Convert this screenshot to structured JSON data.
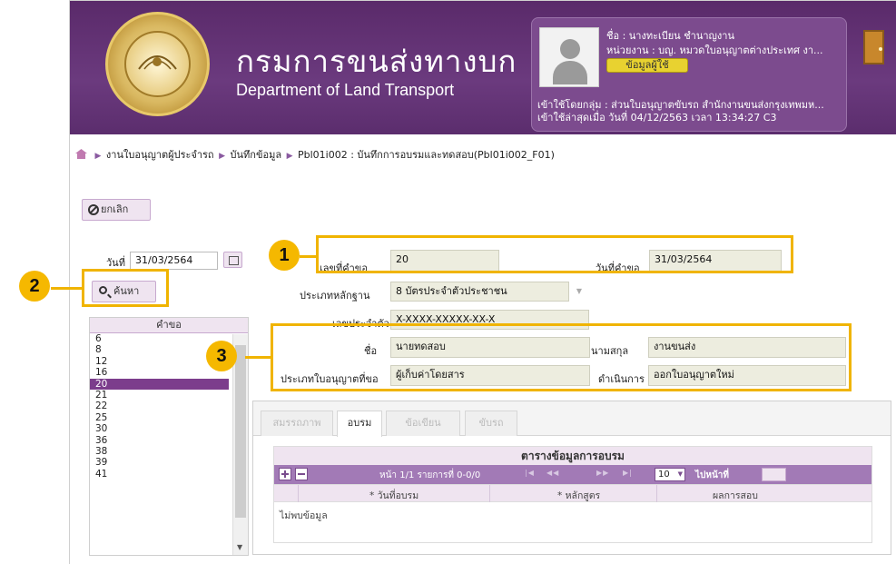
{
  "header": {
    "title_th": "กรมการขนส่งทางบก",
    "title_en": "Department of Land Transport",
    "user_name": "ชื่อ : นางทะเบียน ชำนาญงาน",
    "user_unit": "หน่วยงาน : บญ. หมวดใบอนุญาตต่างประเทศ งา...",
    "user_button": "ข้อมูลผู้ใช้",
    "user_group": "เข้าใช้โดยกลุ่ม : ส่วนใบอนุญาตขับรถ สำนักงานขนส่งกรุงเทพมห...",
    "last_login": "เข้าใช้ล่าสุดเมื่อ วันที่ 04/12/2563 เวลา 13:34:27 C3"
  },
  "breadcrumb": {
    "item1": "งานใบอนุญาตผู้ประจำรถ",
    "item2": "บันทึกข้อมูล",
    "item3": "Pbl01i002 : บันทึกการอบรมและทดสอบ(Pbl01i002_F01)"
  },
  "left": {
    "cancel_label": "ยกเลิก",
    "date_label": "วันที่",
    "date_value": "31/03/2564",
    "search_label": "ค้นหา",
    "list_header": "คำขอ",
    "list_items": [
      "6",
      "8",
      "12",
      "16",
      "20",
      "21",
      "22",
      "25",
      "30",
      "36",
      "38",
      "39",
      "41"
    ],
    "selected_item": "20"
  },
  "form": {
    "req_no_label": "เลขที่คำขอ",
    "req_no_value": "20",
    "req_date_label": "วันที่คำขอ",
    "req_date_value": "31/03/2564",
    "evidence_label": "ประเภทหลักฐาน",
    "evidence_value": "8 บัตรประจำตัวประชาชน",
    "id_label": "เลขประจำตัว",
    "id_value": "X-XXXX-XXXXX-XX-X",
    "name_label": "ชื่อ",
    "name_value": "นายทดสอบ",
    "surname_label": "นามสกุล",
    "surname_value": "งานขนส่ง",
    "license_type_label": "ประเภทใบอนุญาตที่ขอ",
    "license_type_value": "ผู้เก็บค่าโดยสาร",
    "action_label": "ดำเนินการ",
    "action_value": "ออกใบอนุญาตใหม่"
  },
  "tabs": [
    "สมรรถภาพ",
    "อบรม",
    "ข้อเขียน",
    "ขับรถ"
  ],
  "active_tab": "อบรม",
  "grid": {
    "title": "ตารางข้อมูลการอบรม",
    "page_info": "หน้า 1/1 รายการที่ 0-0/0",
    "page_size": "10",
    "goto_label": "ไปหน้าที่",
    "col1": "* วันที่อบรม",
    "col2": "* หลักสูตร",
    "col3": "ผลการสอบ",
    "empty": "ไม่พบข้อมูล"
  },
  "callouts": {
    "one": "1",
    "two": "2",
    "three": "3"
  },
  "colors": {
    "header_purple": "#6b3a7e",
    "selected_row": "#7c3d8c",
    "callout_yellow": "#f0b400"
  }
}
